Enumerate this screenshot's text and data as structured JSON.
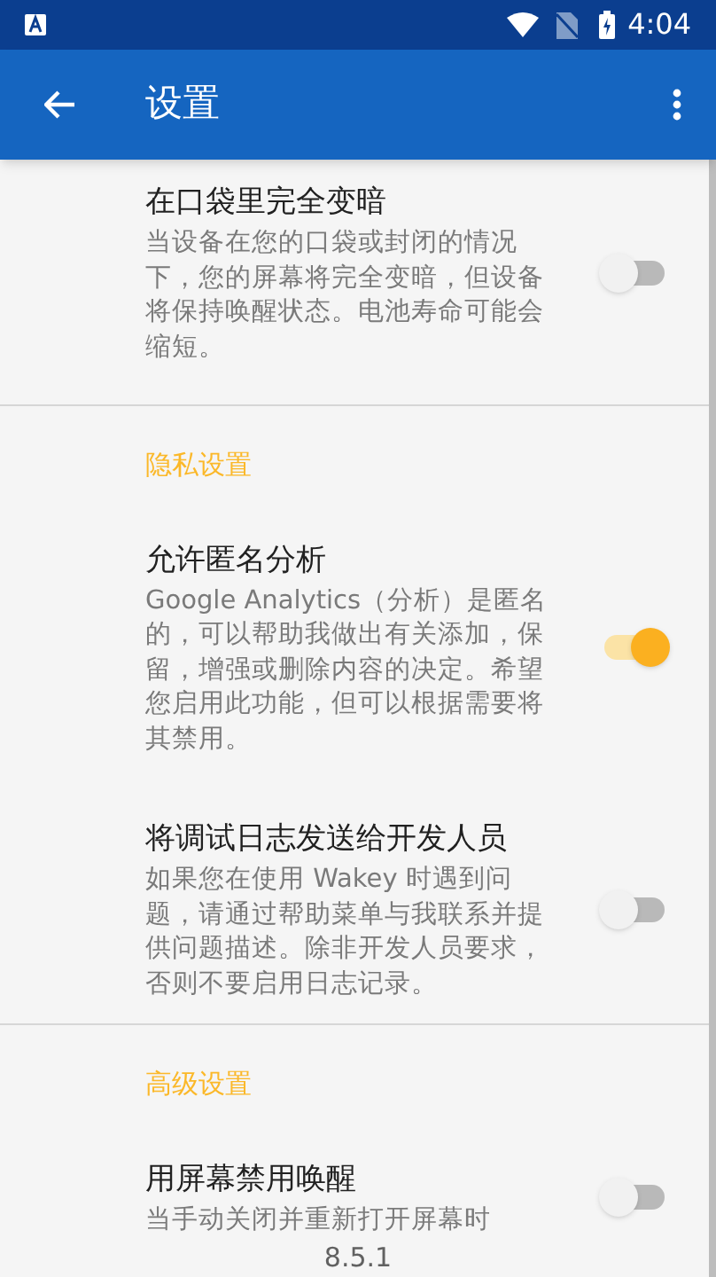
{
  "status_bar": {
    "time": "4:04"
  },
  "app_bar": {
    "title": "设置"
  },
  "sections": [
    {
      "items": [
        {
          "title": "在口袋里完全变暗",
          "summary": "当设备在您的口袋或封闭的情况下，您的屏幕将完全变暗，但设备将保持唤醒状态。电池寿命可能会缩短。",
          "on": false
        }
      ]
    },
    {
      "header": "隐私设置",
      "items": [
        {
          "title": "允许匿名分析",
          "summary": "Google Analytics（分析）是匿名的，可以帮助我做出有关添加，保留，增强或删除内容的决定。希望您启用此功能，但可以根据需要将其禁用。",
          "on": true
        },
        {
          "title": "将调试日志发送给开发人员",
          "summary": "如果您在使用 Wakey 时遇到问题，请通过帮助菜单与我联系并提供问题描述。除非开发人员要求，否则不要启用日志记录。",
          "on": false
        }
      ]
    },
    {
      "header": "高级设置",
      "items": [
        {
          "title": "用屏幕禁用唤醒",
          "summary": "当手动关闭并重新打开屏幕时",
          "on": false
        }
      ]
    }
  ],
  "version": "8.5.1"
}
